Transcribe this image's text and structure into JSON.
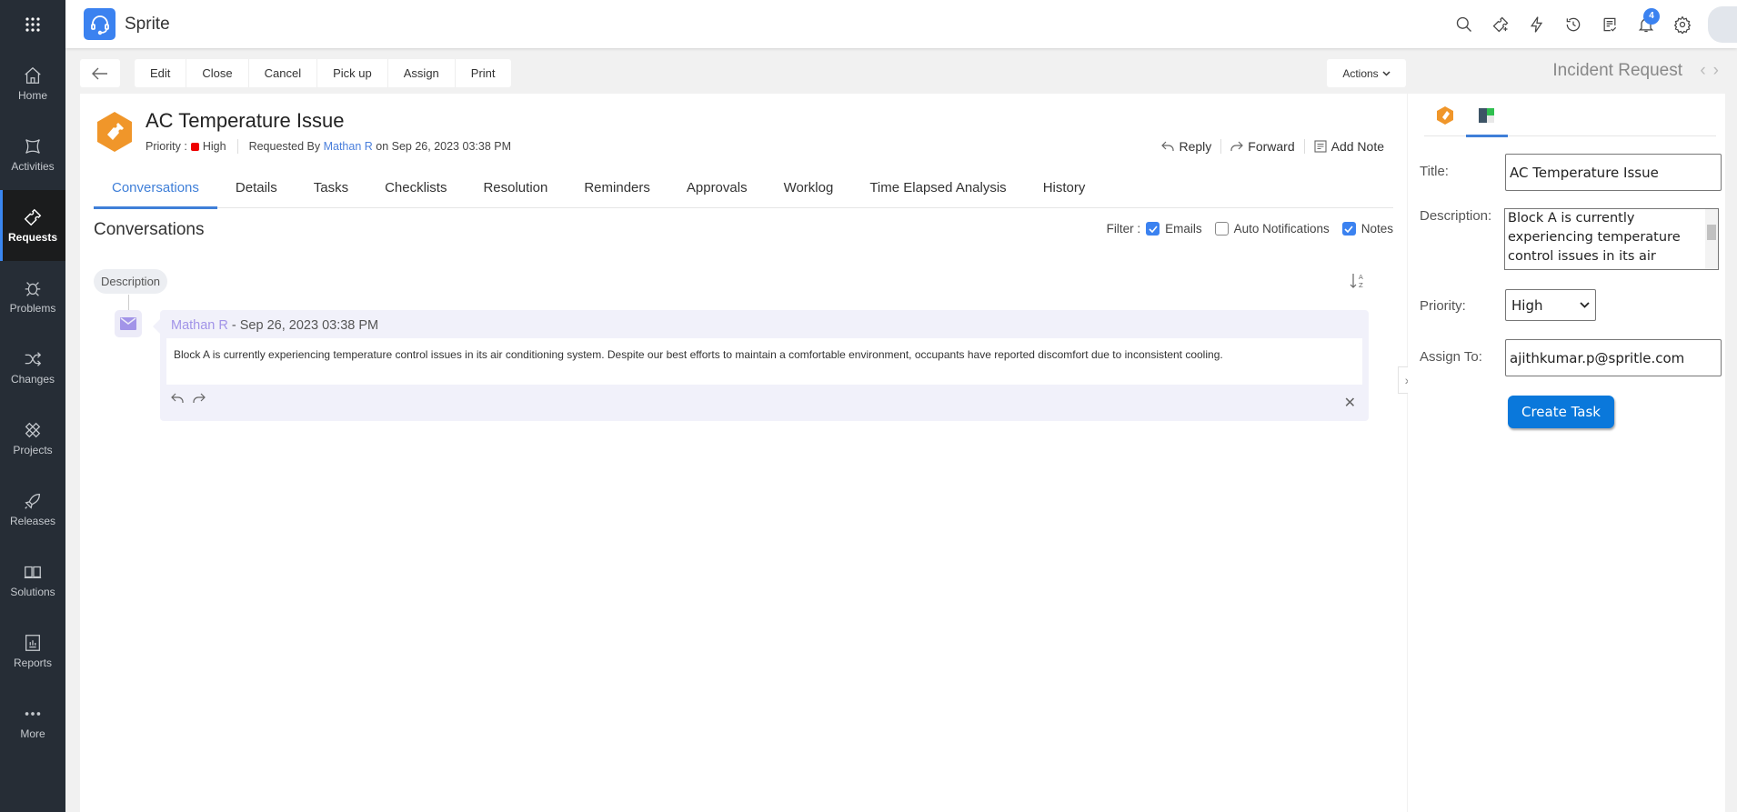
{
  "app": {
    "brand": "Sprite",
    "notification_count": "4"
  },
  "sidebar": {
    "items": [
      {
        "label": "Home",
        "icon": "home-icon"
      },
      {
        "label": "Activities",
        "icon": "activities-icon"
      },
      {
        "label": "Requests",
        "icon": "ticket-icon",
        "active": true
      },
      {
        "label": "Problems",
        "icon": "bug-icon"
      },
      {
        "label": "Changes",
        "icon": "shuffle-icon"
      },
      {
        "label": "Projects",
        "icon": "projects-icon"
      },
      {
        "label": "Releases",
        "icon": "rocket-icon"
      },
      {
        "label": "Solutions",
        "icon": "book-icon"
      },
      {
        "label": "Reports",
        "icon": "report-icon"
      },
      {
        "label": "More",
        "icon": "more-icon"
      }
    ]
  },
  "toolbar": {
    "buttons": [
      "Edit",
      "Close",
      "Cancel",
      "Pick up",
      "Assign",
      "Print"
    ],
    "actions_label": "Actions"
  },
  "request_type": "Incident Request",
  "request": {
    "title": "AC Temperature Issue",
    "priority_label": "Priority :",
    "priority": "High",
    "priority_color": "#e00000",
    "requested_by_label": "Requested By",
    "requester": "Mathan R",
    "on_date": "on Sep 26, 2023 03:38 PM"
  },
  "header_actions": {
    "reply": "Reply",
    "forward": "Forward",
    "add_note": "Add Note"
  },
  "tabs": [
    "Conversations",
    "Details",
    "Tasks",
    "Checklists",
    "Resolution",
    "Reminders",
    "Approvals",
    "Worklog",
    "Time Elapsed Analysis",
    "History"
  ],
  "conversations": {
    "title": "Conversations",
    "filter_label": "Filter :",
    "filters": [
      {
        "label": "Emails",
        "checked": true
      },
      {
        "label": "Auto Notifications",
        "checked": false
      },
      {
        "label": "Notes",
        "checked": true
      }
    ],
    "description_pill": "Description",
    "entry": {
      "author": "Mathan R",
      "date": "- Sep 26, 2023 03:38 PM",
      "body": "Block A is currently experiencing temperature control issues in its air conditioning system. Despite our best efforts to maintain a comfortable environment, occupants have reported discomfort due to inconsistent cooling."
    }
  },
  "task_form": {
    "title_label": "Title:",
    "title_value": "AC Temperature Issue",
    "description_label": "Description:",
    "description_value": "Block A is currently experiencing temperature control issues in its air conditioning system.",
    "priority_label": "Priority:",
    "priority_value": "High",
    "assign_label": "Assign To:",
    "assign_value": "ajithkumar.p@spritle.com",
    "create_label": "Create Task"
  },
  "colors": {
    "accent": "#3f7fd8",
    "sidebar": "#262d36",
    "create_button": "#0a78db",
    "ticket_icon": "#f0962a"
  }
}
